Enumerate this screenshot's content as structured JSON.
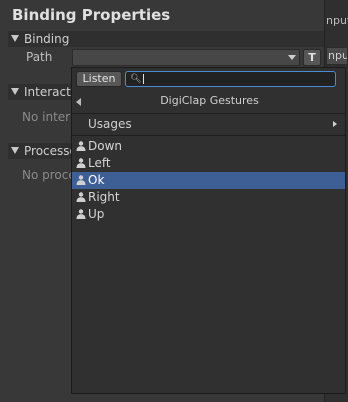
{
  "panel": {
    "title": "Binding Properties",
    "sections": {
      "binding": "Binding",
      "interactions": "Interactio",
      "processors": "Processo"
    },
    "path_label": "Path",
    "t_button": "T",
    "no_interactions": "No inter",
    "no_processors": "No proce"
  },
  "right_panel": {
    "tab_text": "nput",
    "field_text": "nput"
  },
  "popup": {
    "listen_label": "Listen",
    "search_value": "",
    "header_title": "DigiClap Gestures",
    "usages_label": "Usages",
    "items": [
      {
        "label": "Down",
        "icon": "person-icon",
        "selected": false
      },
      {
        "label": "Left",
        "icon": "person-icon",
        "selected": false
      },
      {
        "label": "Ok",
        "icon": "person-icon",
        "selected": true
      },
      {
        "label": "Right",
        "icon": "person-icon",
        "selected": false
      },
      {
        "label": "Up",
        "icon": "person-icon",
        "selected": false
      }
    ]
  },
  "colors": {
    "selection": "#3e5f96",
    "search_focus": "#4b8bd4"
  }
}
